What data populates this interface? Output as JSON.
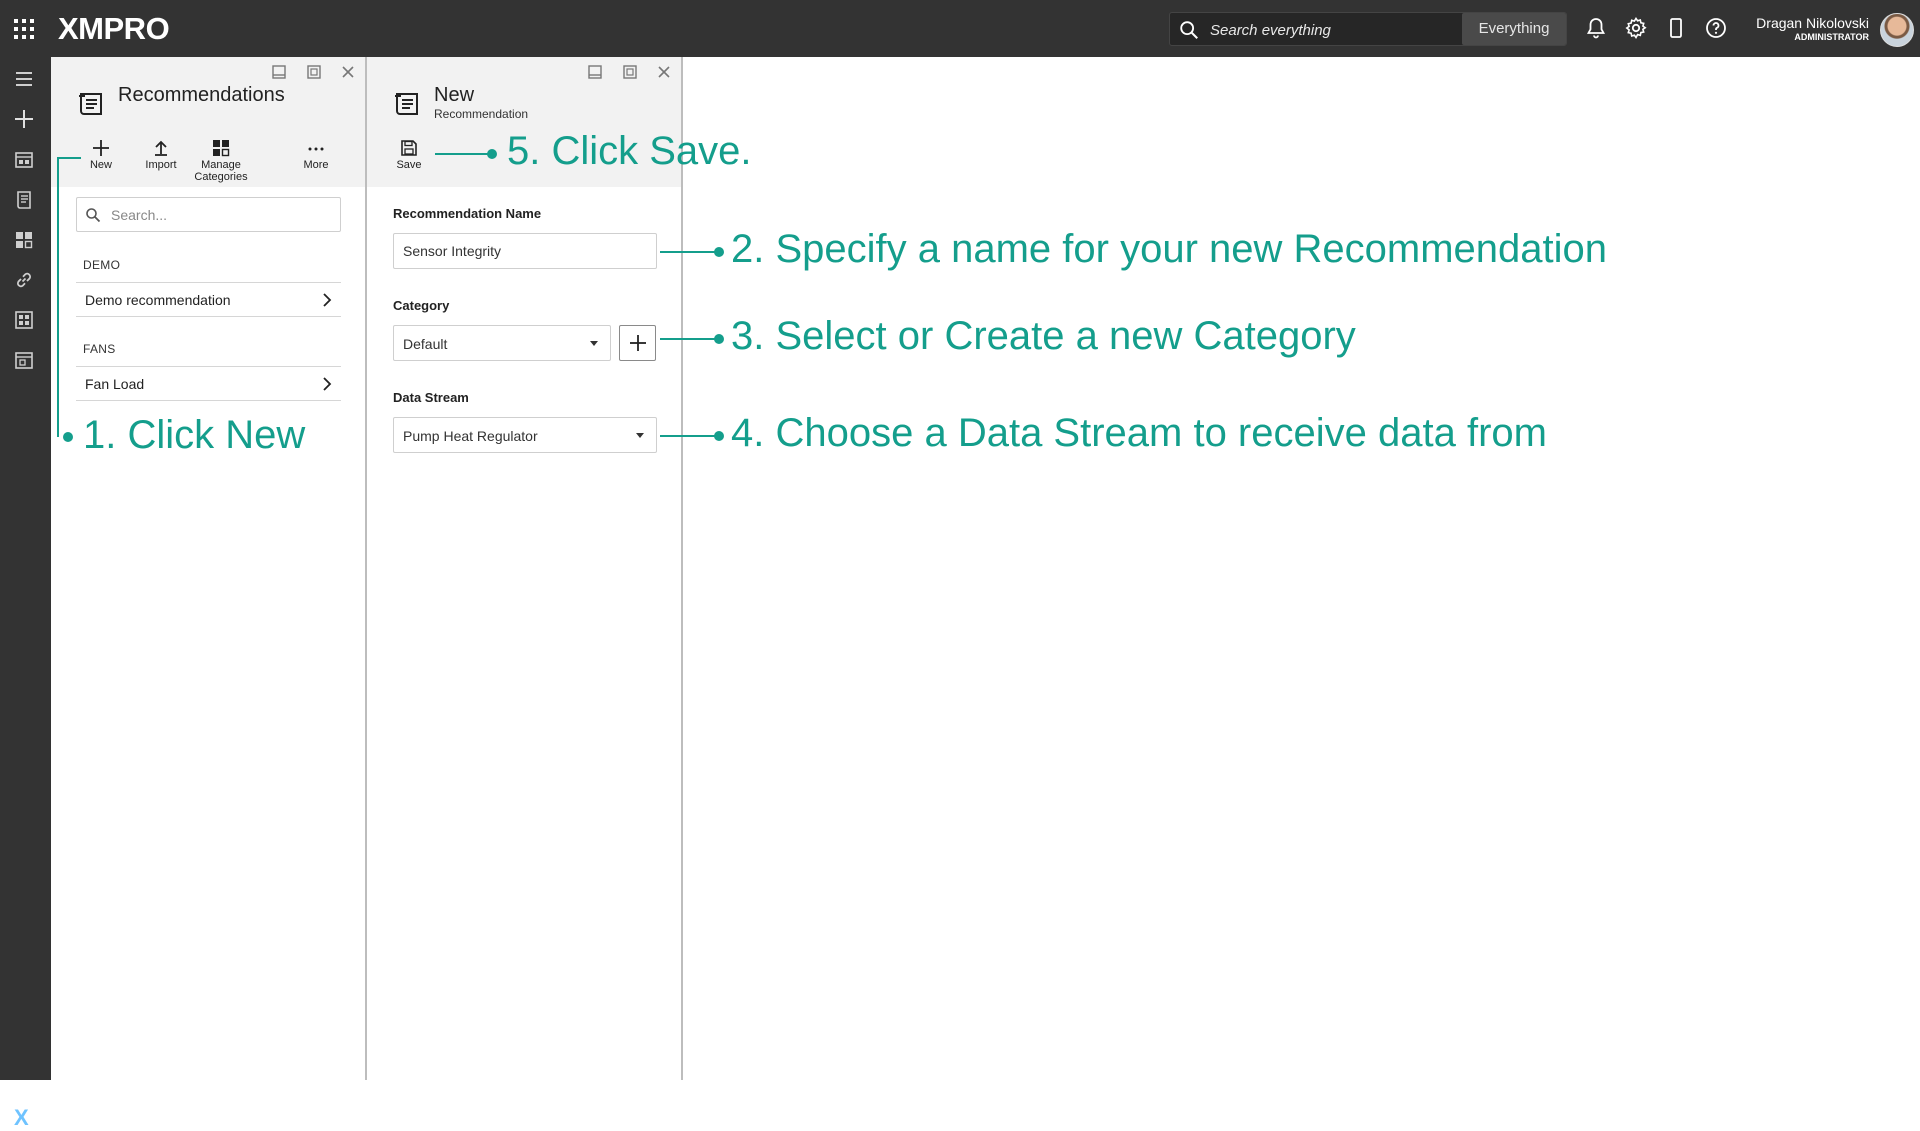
{
  "app": {
    "logo_text": "XMPRO",
    "search_placeholder": "Search everything",
    "search_scope": "Everything",
    "user_name": "Dragan Nikolovski",
    "user_role": "ADMINISTRATOR"
  },
  "recommendations_panel": {
    "title": "Recommendations",
    "toolbar": {
      "new": "New",
      "import": "Import",
      "manage_line1": "Manage",
      "manage_line2": "Categories",
      "more": "More"
    },
    "search_placeholder": "Search...",
    "groups": [
      {
        "label": "DEMO",
        "items": [
          "Demo recommendation"
        ]
      },
      {
        "label": "FANS",
        "items": [
          "Fan Load"
        ]
      }
    ]
  },
  "new_panel": {
    "title": "New",
    "subtitle": "Recommendation",
    "save_label": "Save",
    "name_label": "Recommendation Name",
    "name_value": "Sensor Integrity",
    "category_label": "Category",
    "category_value": "Default",
    "datastream_label": "Data Stream",
    "datastream_value": "Pump Heat Regulator"
  },
  "annotations": {
    "step1": "1. Click New",
    "step2": "2. Specify a name for your new Recommendation",
    "step3": "3. Select or Create a new Category",
    "step4": "4. Choose a Data Stream to receive data from",
    "step5": "5. Click Save."
  },
  "colors": {
    "topbar": "#333333",
    "annotation": "#149e8c",
    "panel_header": "#f2f2f2"
  }
}
